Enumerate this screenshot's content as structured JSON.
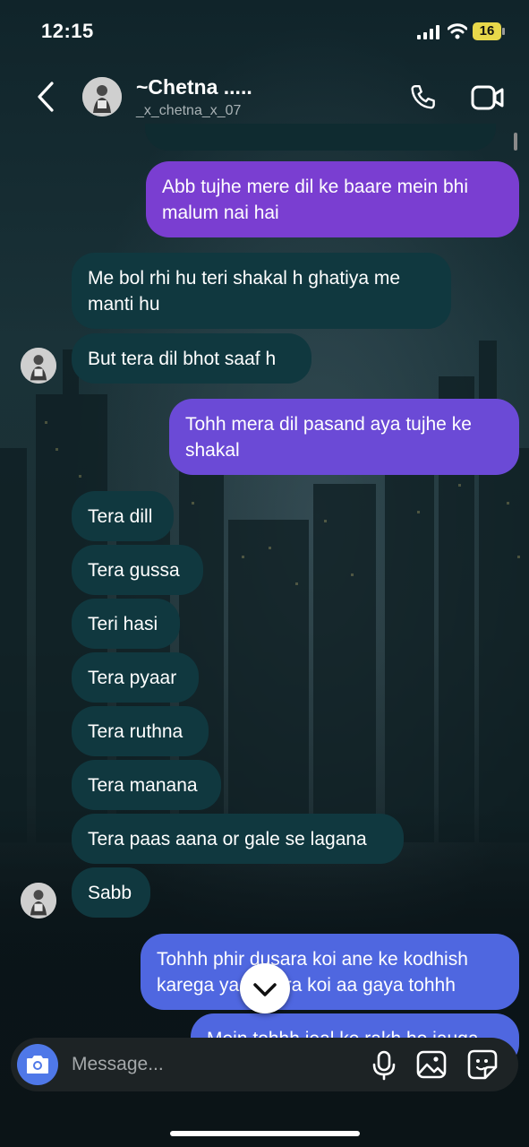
{
  "status_bar": {
    "time": "12:15",
    "battery": "16"
  },
  "header": {
    "name": "~Chetna .....",
    "username": "_x_chetna_x_07"
  },
  "messages": {
    "m1": "Abb tujhe mere dil ke baare mein bhi malum nai hai",
    "m2": "Me bol rhi hu teri shakal h ghatiya me manti hu",
    "m3": "But tera dil bhot saaf h",
    "m4": "Tohh mera dil pasand aya tujhe ke shakal",
    "m5": "Tera dill",
    "m6": "Tera gussa",
    "m7": "Teri hasi",
    "m8": "Tera pyaar",
    "m9": "Tera ruthna",
    "m10": "Tera manana",
    "m11": "Tera paas aana or gale se lagana",
    "m12": "Sabb",
    "m13": "Tohhh phir dusara koi ane ke kodhish karega ya dusara koi aa gaya tohhh",
    "m14": "Mein tohhh jeal ke rakh ho jauga"
  },
  "composer": {
    "placeholder": "Message..."
  },
  "icons": {
    "back": "chevron-left-icon",
    "call": "phone-icon",
    "video": "video-camera-icon",
    "camera": "camera-icon",
    "mic": "microphone-icon",
    "gallery": "image-icon",
    "sticker": "sticker-icon",
    "scroll_down": "chevron-down-icon"
  },
  "colors": {
    "incoming_bubble": "#10383f",
    "outgoing_purple": "#7a3ed1",
    "outgoing_violet": "#6b4ad6",
    "outgoing_blue": "#4f67e0",
    "accent": "#4f78e8"
  }
}
